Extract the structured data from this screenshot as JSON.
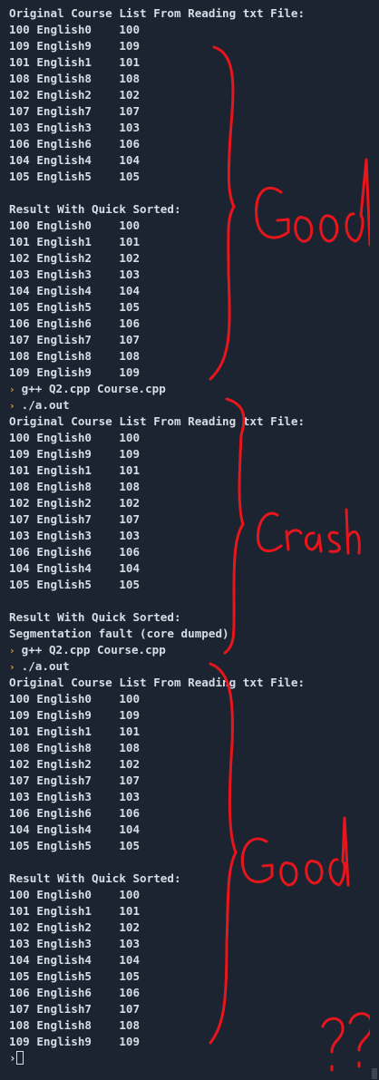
{
  "terminal": {
    "lines": [
      {
        "type": "text",
        "text": "Original Course List From Reading txt File:"
      },
      {
        "type": "text",
        "text": "100 English0    100"
      },
      {
        "type": "text",
        "text": "109 English9    109"
      },
      {
        "type": "text",
        "text": "101 English1    101"
      },
      {
        "type": "text",
        "text": "108 English8    108"
      },
      {
        "type": "text",
        "text": "102 English2    102"
      },
      {
        "type": "text",
        "text": "107 English7    107"
      },
      {
        "type": "text",
        "text": "103 English3    103"
      },
      {
        "type": "text",
        "text": "106 English6    106"
      },
      {
        "type": "text",
        "text": "104 English4    104"
      },
      {
        "type": "text",
        "text": "105 English5    105"
      },
      {
        "type": "text",
        "text": ""
      },
      {
        "type": "text",
        "text": "Result With Quick Sorted:"
      },
      {
        "type": "text",
        "text": "100 English0    100"
      },
      {
        "type": "text",
        "text": "101 English1    101"
      },
      {
        "type": "text",
        "text": "102 English2    102"
      },
      {
        "type": "text",
        "text": "103 English3    103"
      },
      {
        "type": "text",
        "text": "104 English4    104"
      },
      {
        "type": "text",
        "text": "105 English5    105"
      },
      {
        "type": "text",
        "text": "106 English6    106"
      },
      {
        "type": "text",
        "text": "107 English7    107"
      },
      {
        "type": "text",
        "text": "108 English8    108"
      },
      {
        "type": "text",
        "text": "109 English9    109"
      },
      {
        "type": "prompt",
        "text": "g++ Q2.cpp Course.cpp"
      },
      {
        "type": "prompt",
        "text": "./a.out"
      },
      {
        "type": "text",
        "text": "Original Course List From Reading txt File:"
      },
      {
        "type": "text",
        "text": "100 English0    100"
      },
      {
        "type": "text",
        "text": "109 English9    109"
      },
      {
        "type": "text",
        "text": "101 English1    101"
      },
      {
        "type": "text",
        "text": "108 English8    108"
      },
      {
        "type": "text",
        "text": "102 English2    102"
      },
      {
        "type": "text",
        "text": "107 English7    107"
      },
      {
        "type": "text",
        "text": "103 English3    103"
      },
      {
        "type": "text",
        "text": "106 English6    106"
      },
      {
        "type": "text",
        "text": "104 English4    104"
      },
      {
        "type": "text",
        "text": "105 English5    105"
      },
      {
        "type": "text",
        "text": ""
      },
      {
        "type": "text",
        "text": "Result With Quick Sorted:"
      },
      {
        "type": "text",
        "text": "Segmentation fault (core dumped)"
      },
      {
        "type": "prompt",
        "text": "g++ Q2.cpp Course.cpp"
      },
      {
        "type": "prompt",
        "text": "./a.out"
      },
      {
        "type": "text",
        "text": "Original Course List From Reading txt File:"
      },
      {
        "type": "text",
        "text": "100 English0    100"
      },
      {
        "type": "text",
        "text": "109 English9    109"
      },
      {
        "type": "text",
        "text": "101 English1    101"
      },
      {
        "type": "text",
        "text": "108 English8    108"
      },
      {
        "type": "text",
        "text": "102 English2    102"
      },
      {
        "type": "text",
        "text": "107 English7    107"
      },
      {
        "type": "text",
        "text": "103 English3    103"
      },
      {
        "type": "text",
        "text": "106 English6    106"
      },
      {
        "type": "text",
        "text": "104 English4    104"
      },
      {
        "type": "text",
        "text": "105 English5    105"
      },
      {
        "type": "text",
        "text": ""
      },
      {
        "type": "text",
        "text": "Result With Quick Sorted:"
      },
      {
        "type": "text",
        "text": "100 English0    100"
      },
      {
        "type": "text",
        "text": "101 English1    101"
      },
      {
        "type": "text",
        "text": "102 English2    102"
      },
      {
        "type": "text",
        "text": "103 English3    103"
      },
      {
        "type": "text",
        "text": "104 English4    104"
      },
      {
        "type": "text",
        "text": "105 English5    105"
      },
      {
        "type": "text",
        "text": "106 English6    106"
      },
      {
        "type": "text",
        "text": "107 English7    107"
      },
      {
        "type": "text",
        "text": "108 English8    108"
      },
      {
        "type": "text",
        "text": "109 English9    109"
      },
      {
        "type": "cursor",
        "text": ""
      }
    ],
    "prompt_icon": "chevron-right-icon"
  },
  "annotations": {
    "first": "Good",
    "second": "Crash",
    "third": "Good",
    "question": "??"
  },
  "colors": {
    "background": "#1b2430",
    "text": "#d7dde6",
    "prompt": "#d9a13c",
    "annotation": "#e8161c"
  }
}
